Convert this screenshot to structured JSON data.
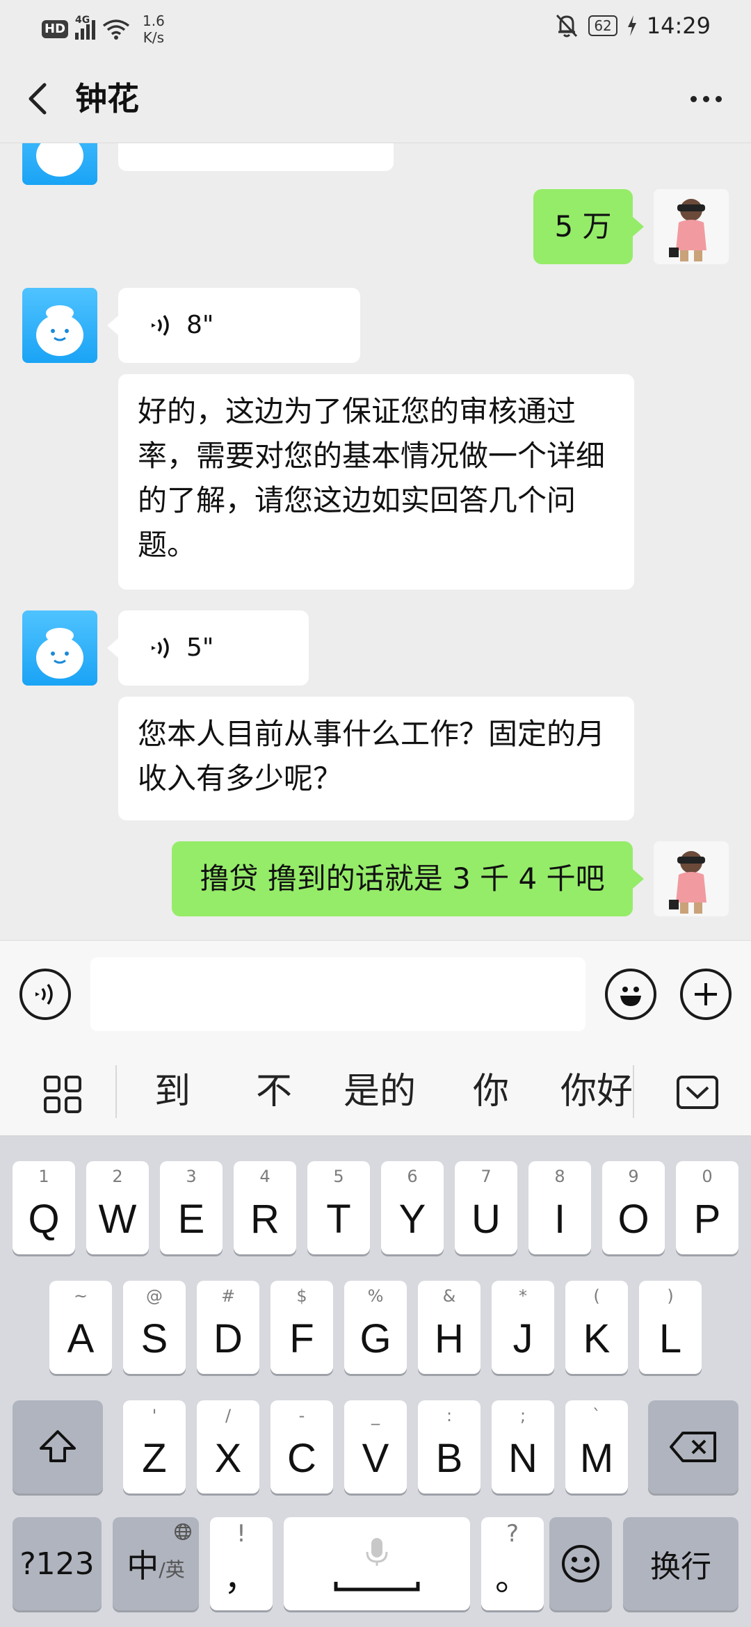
{
  "status": {
    "hd": "HD",
    "network_type": "4G",
    "speed_value": "1.6",
    "speed_unit": "K/s",
    "battery": "62",
    "time": "14:29"
  },
  "header": {
    "title": "钟花"
  },
  "messages": [
    {
      "side": "right",
      "text": "5 万"
    },
    {
      "side": "left",
      "kind": "voice",
      "duration": "8\""
    },
    {
      "side": "left",
      "text": "好的，这边为了保证您的审核通过率，需要对您的基本情况做一个详细的了解，请您这边如实回答几个问题。"
    },
    {
      "side": "left",
      "kind": "voice",
      "duration": "5\""
    },
    {
      "side": "left",
      "text": "您本人目前从事什么工作？固定的月收入有多少呢？"
    },
    {
      "side": "right",
      "text": "撸贷 撸到的话就是 3 千 4 千吧"
    }
  ],
  "candidates": [
    "到",
    "不",
    "是的",
    "你",
    "你好"
  ],
  "keyboard": {
    "row1": [
      {
        "k": "Q",
        "s": "1"
      },
      {
        "k": "W",
        "s": "2"
      },
      {
        "k": "E",
        "s": "3"
      },
      {
        "k": "R",
        "s": "4"
      },
      {
        "k": "T",
        "s": "5"
      },
      {
        "k": "Y",
        "s": "6"
      },
      {
        "k": "U",
        "s": "7"
      },
      {
        "k": "I",
        "s": "8"
      },
      {
        "k": "O",
        "s": "9"
      },
      {
        "k": "P",
        "s": "0"
      }
    ],
    "row2": [
      {
        "k": "A",
        "s": "~"
      },
      {
        "k": "S",
        "s": "@"
      },
      {
        "k": "D",
        "s": "#"
      },
      {
        "k": "F",
        "s": "$"
      },
      {
        "k": "G",
        "s": "%"
      },
      {
        "k": "H",
        "s": "&"
      },
      {
        "k": "J",
        "s": "*"
      },
      {
        "k": "K",
        "s": "("
      },
      {
        "k": "L",
        "s": ")"
      }
    ],
    "row3": [
      {
        "k": "Z",
        "s": "'"
      },
      {
        "k": "X",
        "s": "/"
      },
      {
        "k": "C",
        "s": "-"
      },
      {
        "k": "V",
        "s": "_"
      },
      {
        "k": "B",
        "s": ":"
      },
      {
        "k": "N",
        "s": ";"
      },
      {
        "k": "M",
        "s": "`"
      }
    ],
    "num_label": "?123",
    "lang_main": "中",
    "lang_sub": "/英",
    "comma_top": "!",
    "comma_main": "，",
    "period_top": "?",
    "period_main": "。",
    "enter_label": "换行"
  },
  "colors": {
    "bg": "#ededed",
    "green_bubble": "#95ec69",
    "white_bubble": "#ffffff",
    "bot_avatar": "#1aa3f5"
  }
}
